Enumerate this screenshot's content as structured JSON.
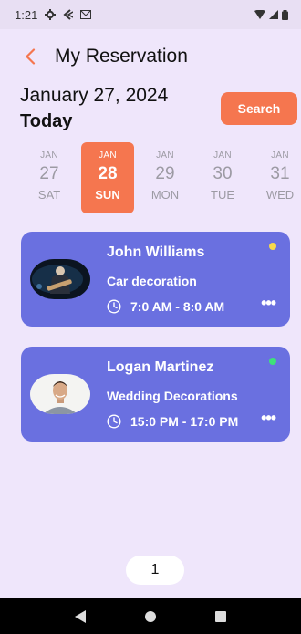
{
  "status_bar": {
    "time": "1:21"
  },
  "header": {
    "title": "My Reservation"
  },
  "date_section": {
    "date": "January 27, 2024",
    "today_label": "Today",
    "search_label": "Search"
  },
  "days": [
    {
      "month": "JAN",
      "day": "27",
      "weekday": "SAT",
      "selected": false
    },
    {
      "month": "JAN",
      "day": "28",
      "weekday": "SUN",
      "selected": true
    },
    {
      "month": "JAN",
      "day": "29",
      "weekday": "MON",
      "selected": false
    },
    {
      "month": "JAN",
      "day": "30",
      "weekday": "TUE",
      "selected": false
    },
    {
      "month": "JAN",
      "day": "31",
      "weekday": "WED",
      "selected": false
    }
  ],
  "reservations": [
    {
      "name": "John Williams",
      "service": "Car decoration",
      "time": "7:0 AM - 8:0 AM",
      "status_color": "#f7d94c"
    },
    {
      "name": "Logan Martinez",
      "service": "Wedding Decorations",
      "time": "15:0 PM - 17:0 PM",
      "status_color": "#3ee07a"
    }
  ],
  "pagination": {
    "page": "1"
  },
  "colors": {
    "accent": "#f5764f",
    "card": "#6a70e0",
    "background": "#efe6fb"
  }
}
